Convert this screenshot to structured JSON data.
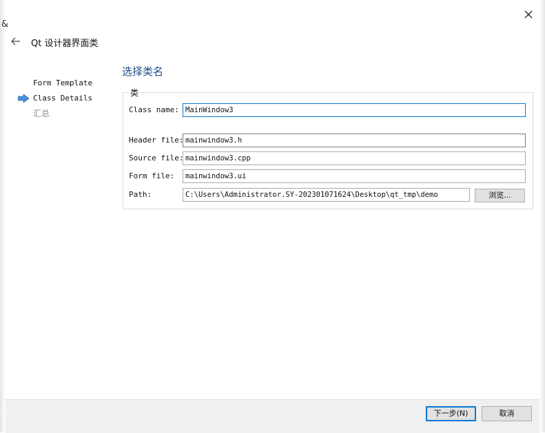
{
  "window": {
    "title": "Qt 设计器界面类",
    "edge_glyph": "&",
    "icons": {
      "close": "close-icon",
      "back": "back-arrow-icon"
    }
  },
  "steps": [
    {
      "label": "Form Template",
      "state": "done"
    },
    {
      "label": "Class Details",
      "state": "current"
    },
    {
      "label": "汇总",
      "state": "pending"
    }
  ],
  "page": {
    "heading": "选择类名",
    "group_title": "类"
  },
  "fields": {
    "class_name": {
      "label": "Class name:",
      "value": "MainWindow3"
    },
    "header_file": {
      "label": "Header file:",
      "value": "mainwindow3.h"
    },
    "source_file": {
      "label": "Source file:",
      "value": "mainwindow3.cpp"
    },
    "form_file": {
      "label": "Form file:",
      "value": "mainwindow3.ui"
    },
    "path": {
      "label": "Path:",
      "value": "C:\\Users\\Administrator.SY-202301071624\\Desktop\\qt_tmp\\demo"
    }
  },
  "buttons": {
    "browse": "浏览...",
    "next": "下一步(N)",
    "cancel": "取消"
  },
  "colors": {
    "heading": "#1d4a87",
    "focus_border": "#0078d7",
    "step_arrow": "#4a90d9",
    "footer_bg": "#f0f0f0"
  }
}
